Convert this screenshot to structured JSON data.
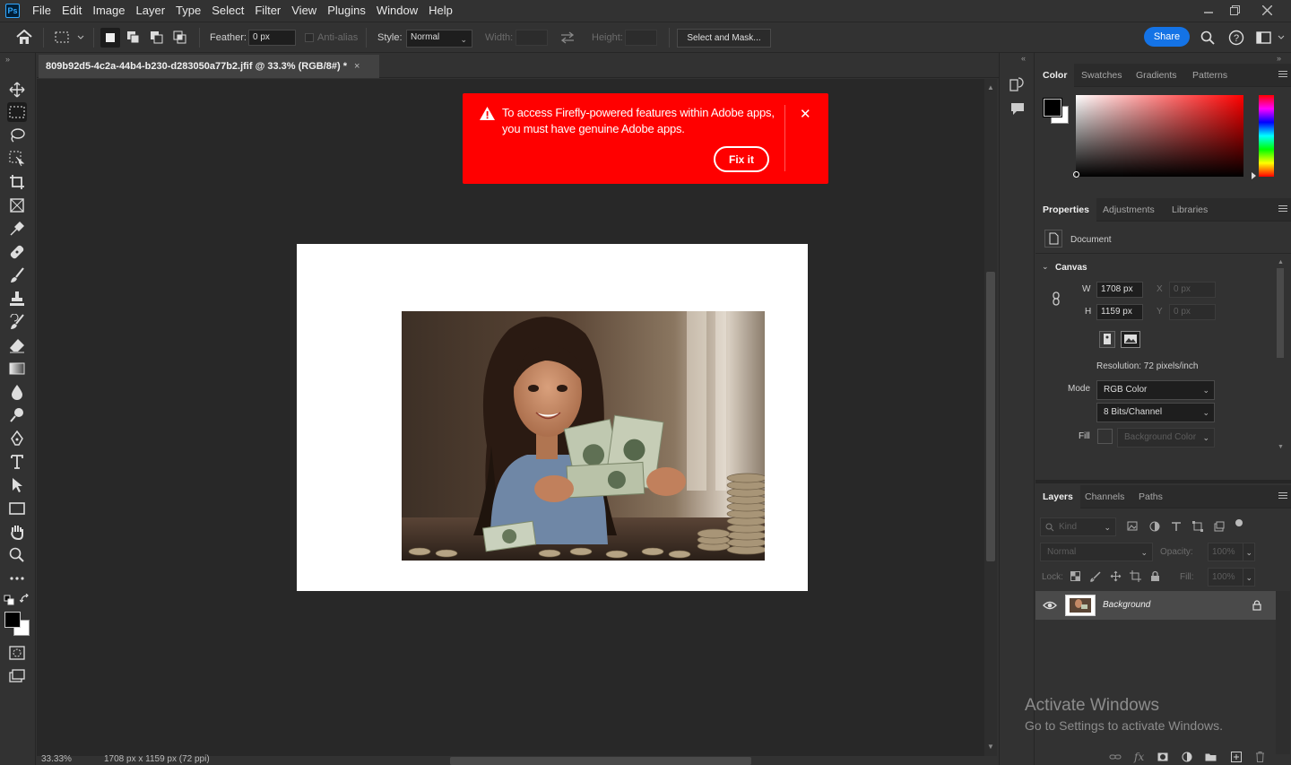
{
  "menubar": {
    "logo": "Ps",
    "items": [
      "File",
      "Edit",
      "Image",
      "Layer",
      "Type",
      "Select",
      "Filter",
      "View",
      "Plugins",
      "Window",
      "Help"
    ]
  },
  "options": {
    "feather_label": "Feather:",
    "feather_value": "0 px",
    "antialias_label": "Anti-alias",
    "style_label": "Style:",
    "style_value": "Normal",
    "width_label": "Width:",
    "height_label": "Height:",
    "select_mask_label": "Select and Mask...",
    "share_label": "Share"
  },
  "document": {
    "tab_title": "809b92d5-4c2a-44b4-b230-d283050a77b2.jfif @ 33.3% (RGB/8#) *",
    "close_glyph": "×",
    "zoom_status": "33.33%",
    "size_status": "1708 px x 1159 px (72 ppi)"
  },
  "alert": {
    "message": "To access Firefly-powered features within Adobe apps, you must have genuine Adobe apps.",
    "fix_label": "Fix it",
    "close_glyph": "✕",
    "bg_color": "#ff0000"
  },
  "color_panel": {
    "tabs": [
      "Color",
      "Swatches",
      "Gradients",
      "Patterns"
    ],
    "foreground": "#000000",
    "background": "#ffffff"
  },
  "properties": {
    "tabs": [
      "Properties",
      "Adjustments",
      "Libraries"
    ],
    "document_label": "Document",
    "canvas_label": "Canvas",
    "w_label": "W",
    "w_value": "1708 px",
    "h_label": "H",
    "h_value": "1159 px",
    "x_label": "X",
    "x_value": "0 px",
    "y_label": "Y",
    "y_value": "0 px",
    "resolution": "Resolution: 72 pixels/inch",
    "mode_label": "Mode",
    "mode_value": "RGB Color",
    "bits_value": "8 Bits/Channel",
    "fill_label": "Fill",
    "fill_value": "Background Color"
  },
  "layers": {
    "tabs": [
      "Layers",
      "Channels",
      "Paths"
    ],
    "kind_label": "Kind",
    "blend_value": "Normal",
    "opacity_label": "Opacity:",
    "opacity_value": "100%",
    "lock_label": "Lock:",
    "fill_label": "Fill:",
    "fill_value": "100%",
    "layer_name": "Background"
  },
  "watermark": {
    "line1": "Activate Windows",
    "line2": "Go to Settings to activate Windows."
  }
}
